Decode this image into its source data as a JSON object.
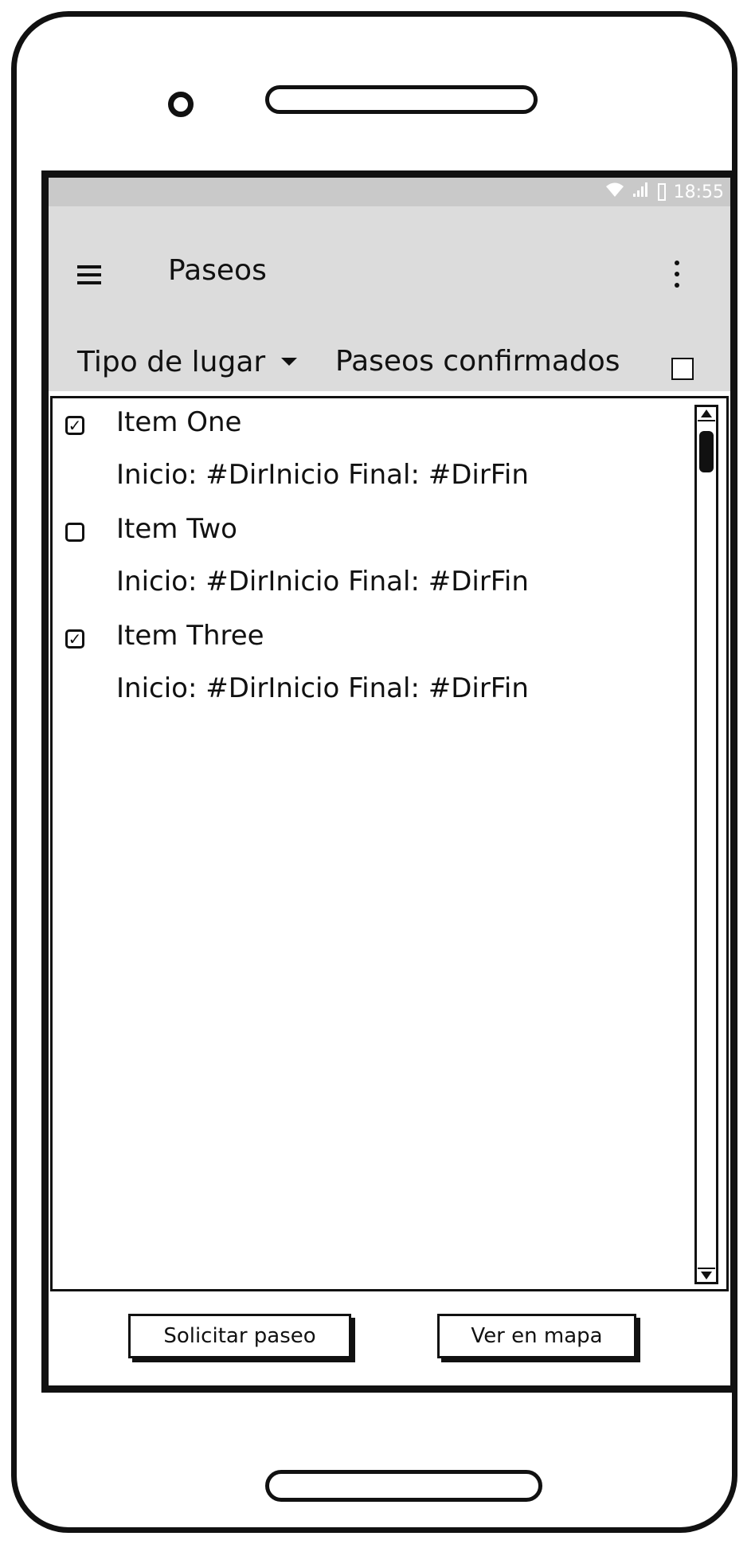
{
  "status_bar": {
    "time": "18:55",
    "icons": [
      "wifi-icon",
      "signal-icon",
      "battery-icon"
    ]
  },
  "app_bar": {
    "title": "Paseos",
    "menu_icon": "hamburger-menu-icon",
    "overflow_icon": "vertical-ellipsis-icon"
  },
  "filters": {
    "place_type_label": "Tipo de lugar",
    "confirmed_label": "Paseos confirmados",
    "confirmed_checked": false
  },
  "list": {
    "items": [
      {
        "title": "Item One",
        "detail": "Inicio: #DirInicio Final: #DirFin",
        "checked": true
      },
      {
        "title": "Item Two",
        "detail": "Inicio: #DirInicio Final: #DirFin",
        "checked": false
      },
      {
        "title": "Item Three",
        "detail": "Inicio: #DirInicio Final: #DirFin",
        "checked": true
      }
    ]
  },
  "actions": {
    "request_label": "Solicitar paseo",
    "map_label": "Ver en mapa"
  },
  "colors": {
    "status_bar_bg": "#c9c9c9",
    "app_bar_bg": "#dcdcdc",
    "stroke": "#111111"
  }
}
